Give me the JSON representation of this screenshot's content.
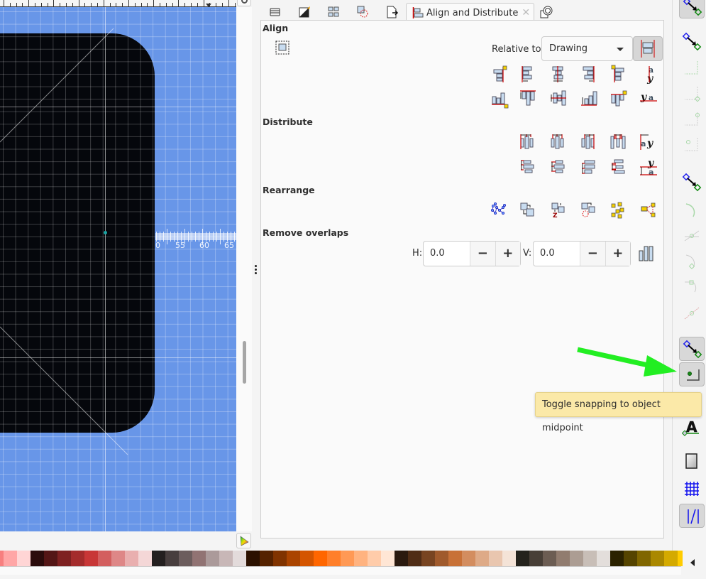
{
  "dock": {
    "tabs": [
      {
        "name": "layers-tab",
        "icon": "layers-icon"
      },
      {
        "name": "fill-stroke-tab",
        "icon": "fill-stroke-icon"
      },
      {
        "name": "objects-tab",
        "icon": "objects-icon"
      },
      {
        "name": "transform-tab",
        "icon": "transform-icon"
      },
      {
        "name": "export-tab",
        "icon": "export-icon"
      },
      {
        "name": "align-distribute-tab",
        "icon": "align-icon",
        "label": "Align and Distribute",
        "active": true
      },
      {
        "name": "clone-tab",
        "icon": "clone-icon"
      }
    ],
    "active_tab_label": "Align and Distribute",
    "close_glyph": "✕"
  },
  "align": {
    "title": "Align",
    "relative_label": "Relative to:",
    "relative_value": "Drawing",
    "row1": [
      "align-right-edges-to-left-anchor",
      "align-left-edges",
      "center-on-vertical-axis",
      "align-right-sides",
      "align-left-edges-to-right-anchor",
      "align-baseline-vertical"
    ],
    "row2": [
      "align-bottom-to-top-anchor",
      "align-top-edges",
      "center-on-horizontal-axis",
      "align-bottom-edges",
      "align-top-to-bottom-anchor",
      "align-baseline-horizontal"
    ]
  },
  "distribute": {
    "title": "Distribute",
    "row1": [
      "distribute-left-edges",
      "distribute-centers-horizontal",
      "distribute-right-edges",
      "distribute-horizontal-gaps",
      "distribute-baselines-horizontal"
    ],
    "row2": [
      "distribute-top-edges",
      "distribute-centers-vertical",
      "distribute-bottom-edges",
      "distribute-vertical-gaps",
      "distribute-baselines-vertical"
    ]
  },
  "rearrange": {
    "title": "Rearrange",
    "buttons": [
      "graph-layout",
      "exchange-selection-order",
      "exchange-z-order",
      "exchange-clockwise",
      "randomize-centers",
      "unclump"
    ]
  },
  "remove_overlaps": {
    "title": "Remove overlaps",
    "h_label": "H:",
    "h_value": "0.0",
    "v_label": "V:",
    "v_value": "0.0",
    "minus": "−",
    "plus": "+"
  },
  "canvas": {
    "measure_labels": [
      "0",
      "55",
      "60",
      "65"
    ]
  },
  "snap_toolbar": {
    "items": [
      {
        "name": "enable-snapping",
        "active": true,
        "dim": false
      },
      {
        "name": "snap-bounding-boxes",
        "active": false,
        "dim": false
      },
      {
        "name": "snap-bbox-edges",
        "active": false,
        "dim": true
      },
      {
        "name": "snap-bbox-corners",
        "active": false,
        "dim": true
      },
      {
        "name": "snap-bbox-edge-midpoints",
        "active": false,
        "dim": true
      },
      {
        "name": "snap-bbox-centers",
        "active": false,
        "dim": true
      },
      {
        "name": "snap-nodes",
        "active": false,
        "dim": false
      },
      {
        "name": "snap-paths",
        "active": false,
        "dim": true
      },
      {
        "name": "snap-path-intersections",
        "active": false,
        "dim": true
      },
      {
        "name": "snap-cusp-nodes",
        "active": false,
        "dim": true
      },
      {
        "name": "snap-smooth-nodes",
        "active": false,
        "dim": true
      },
      {
        "name": "snap-line-midpoints",
        "active": false,
        "dim": true
      },
      {
        "name": "snap-others",
        "active": true,
        "dim": false
      },
      {
        "name": "snap-object-midpoint",
        "active": true,
        "dim": false
      },
      {
        "name": "snap-text-baseline",
        "active": false,
        "dim": false
      },
      {
        "name": "snap-page-border",
        "active": false,
        "dim": false
      },
      {
        "name": "snap-grids",
        "active": false,
        "dim": false
      },
      {
        "name": "snap-guides",
        "active": true,
        "dim": false
      }
    ]
  },
  "tooltip": {
    "text": "Toggle snapping to object midpoint"
  },
  "palette": {
    "colors": [
      "#f77f7f",
      "#ffa6a6",
      "#ffd5d5",
      "#2b0c0c",
      "#541616",
      "#7e2121",
      "#a42c2c",
      "#c83737",
      "#d35f5f",
      "#de8787",
      "#e9afaf",
      "#f4d7d7",
      "#241f1f",
      "#483e3e",
      "#6c5d5d",
      "#917373",
      "#ab9a9a",
      "#c8b7b7",
      "#e3dbdb",
      "#2b1100",
      "#552200",
      "#803300",
      "#aa4400",
      "#d45500",
      "#ff6600",
      "#ff7f2a",
      "#ff9955",
      "#ffb380",
      "#ffccaa",
      "#ffe6d5",
      "#2b1a0f",
      "#502d16",
      "#784421",
      "#a05a2c",
      "#c87137",
      "#d38d5f",
      "#deaa87",
      "#e9c6af",
      "#f4e3d7",
      "#24221c",
      "#483f37",
      "#6c5d53",
      "#917c6f",
      "#ac9d93",
      "#c8beb7",
      "#e3dedb",
      "#2b2200",
      "#554400",
      "#806600",
      "#aa8800",
      "#d4aa00",
      "#ffcc00"
    ]
  }
}
